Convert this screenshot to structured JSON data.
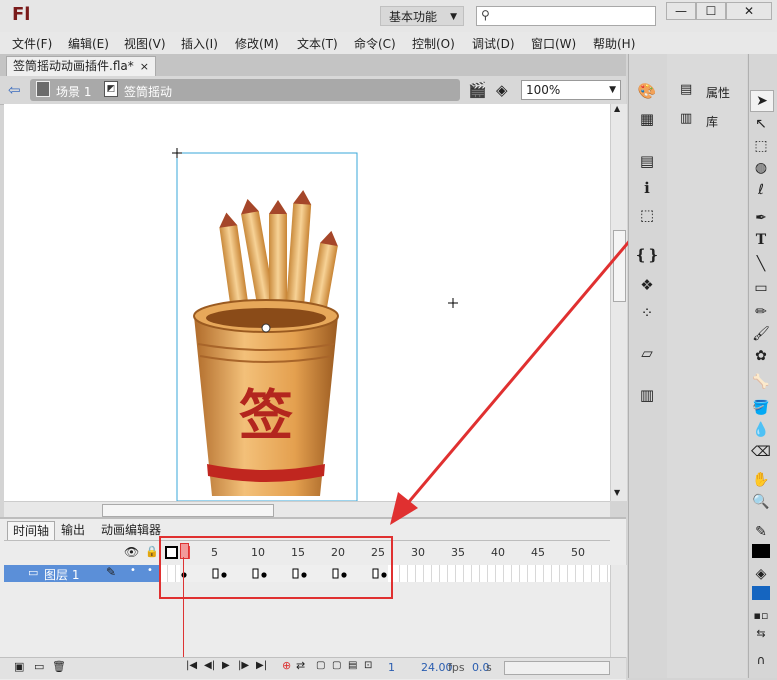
{
  "app": {
    "logo": "Fl",
    "workspace": "基本功能",
    "search_placeholder": ""
  },
  "window_controls": {
    "minimize": "—",
    "maximize": "☐",
    "close": "✕"
  },
  "menu": [
    "文件(F)",
    "编辑(E)",
    "视图(V)",
    "插入(I)",
    "修改(M)",
    "文本(T)",
    "命令(C)",
    "控制(O)",
    "调试(D)",
    "窗口(W)",
    "帮助(H)"
  ],
  "document": {
    "tab_title": "签筒摇动动画插件.fla*",
    "close": "×"
  },
  "editbar": {
    "scene": "场景 1",
    "symbol": "签筒摇动",
    "zoom": "100%"
  },
  "stage": {
    "cup_character": "签"
  },
  "panels": {
    "properties": "属性",
    "library": "库"
  },
  "timeline": {
    "tabs": [
      "时间轴",
      "输出",
      "动画编辑器"
    ],
    "frame_numbers": [
      "1",
      "5",
      "10",
      "15",
      "20",
      "25",
      "30",
      "35",
      "40",
      "45",
      "50"
    ],
    "layer_name": "图层 1",
    "current_frame": "1",
    "fps": "24.00",
    "fps_unit": "fps",
    "time": "0.0",
    "time_unit": "s",
    "keyframes": [
      1,
      5,
      6,
      10,
      11,
      15,
      16,
      20,
      21,
      25,
      26
    ]
  },
  "colors": {
    "accent": "#e03030",
    "layer_highlight": "#5b8fd8",
    "fill_color": "#1565c0"
  }
}
